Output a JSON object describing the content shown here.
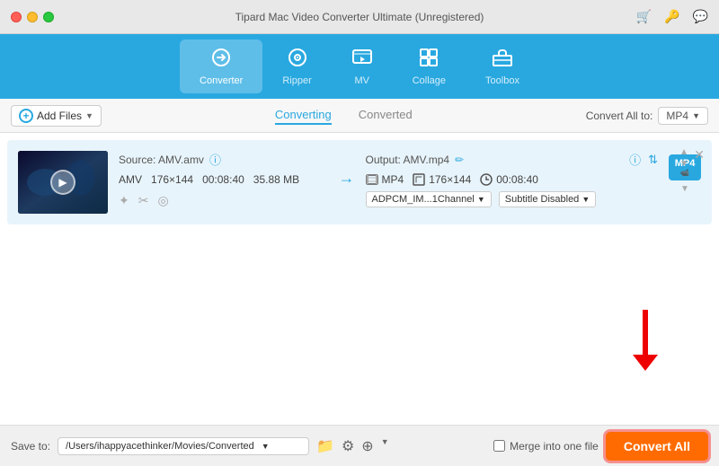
{
  "titleBar": {
    "title": "Tipard Mac Video Converter Ultimate (Unregistered)"
  },
  "nav": {
    "items": [
      {
        "id": "converter",
        "label": "Converter",
        "icon": "🔄",
        "active": true
      },
      {
        "id": "ripper",
        "label": "Ripper",
        "icon": "💿",
        "active": false
      },
      {
        "id": "mv",
        "label": "MV",
        "icon": "🖼",
        "active": false
      },
      {
        "id": "collage",
        "label": "Collage",
        "icon": "⊞",
        "active": false
      },
      {
        "id": "toolbox",
        "label": "Toolbox",
        "icon": "🧰",
        "active": false
      }
    ]
  },
  "toolbar": {
    "addFilesLabel": "Add Files",
    "tabs": [
      {
        "id": "converting",
        "label": "Converting",
        "active": true
      },
      {
        "id": "converted",
        "label": "Converted",
        "active": false
      }
    ],
    "convertAllToLabel": "Convert All to:",
    "formatLabel": "MP4"
  },
  "fileRow": {
    "source": "Source: AMV.amv",
    "output": "Output: AMV.mp4",
    "format": "AMV",
    "resolution": "176×144",
    "duration": "00:08:40",
    "size": "35.88 MB",
    "outputFormat": "MP4",
    "outputResolution": "176×144",
    "outputDuration": "00:08:40",
    "audioDropdown": "ADPCM_IM...1Channel",
    "subtitleDropdown": "Subtitle Disabled",
    "formatBadge": "MP4"
  },
  "bottomBar": {
    "saveToLabel": "Save to:",
    "savePath": "/Users/ihappyacethinker/Movies/Converted",
    "mergeLabel": "Merge into one file",
    "convertAllLabel": "Convert All"
  }
}
